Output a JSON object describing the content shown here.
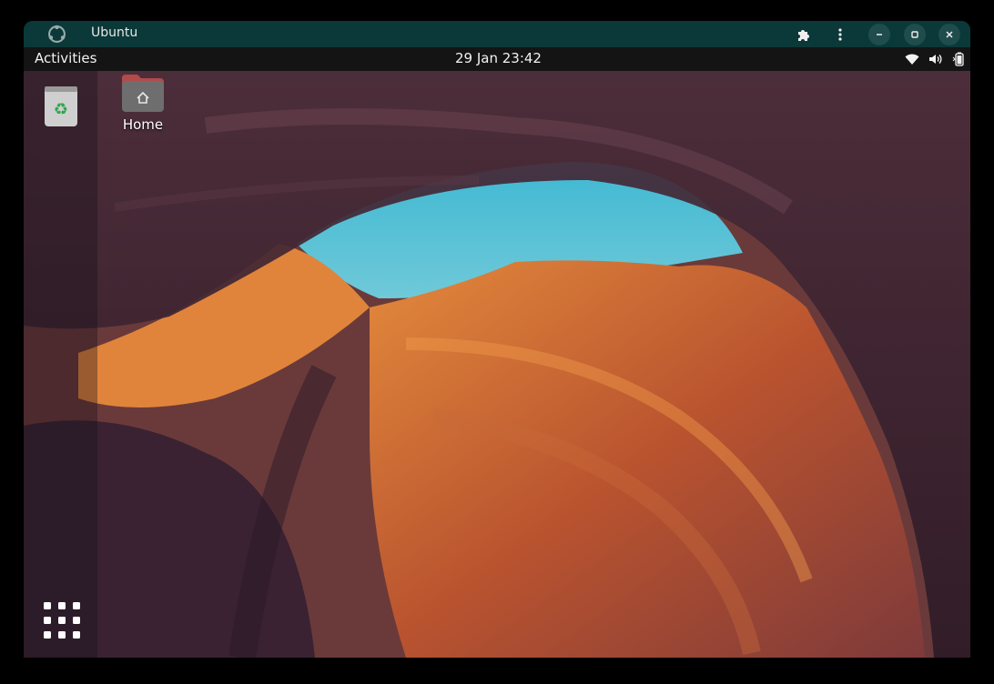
{
  "window": {
    "title": "Ubuntu",
    "controls": [
      "extensions",
      "menu",
      "minimize",
      "maximize",
      "close"
    ]
  },
  "topbar": {
    "activities_label": "Activities",
    "clock": "29 Jan 23:42",
    "status_icons": [
      "wifi-icon",
      "volume-icon",
      "battery-icon"
    ]
  },
  "desktop": {
    "icons": [
      {
        "name": "trash",
        "label": ""
      },
      {
        "name": "home-folder",
        "label": "Home"
      }
    ],
    "wallpaper": "canyon",
    "show_apps_icon": "app-grid-icon"
  },
  "colors": {
    "titlebar": "#0b3838",
    "topbar": "#141414",
    "folder_tab": "#b24a4a",
    "folder_body": "#6e6e6e"
  }
}
